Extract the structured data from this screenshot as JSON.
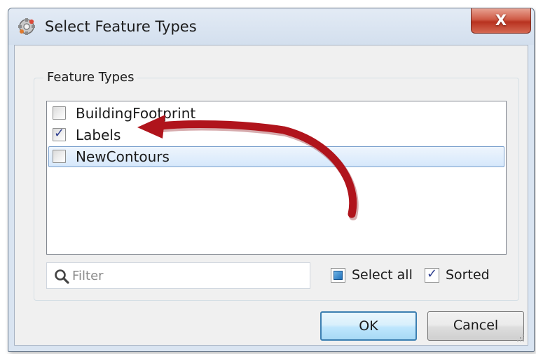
{
  "window": {
    "title": "Select Feature Types",
    "close_label": "X"
  },
  "feature_types": {
    "group_label": "Feature Types",
    "items": [
      {
        "label": "BuildingFootprint",
        "checked": false
      },
      {
        "label": "Labels",
        "checked": true
      },
      {
        "label": "NewContours",
        "checked": false,
        "selected": true
      }
    ]
  },
  "filter": {
    "placeholder": "Filter",
    "value": ""
  },
  "options": {
    "select_all_label": "Select all",
    "sorted_label": "Sorted",
    "sorted_checked": true
  },
  "buttons": {
    "ok": "OK",
    "cancel": "Cancel"
  },
  "colors": {
    "annotation_arrow": "#b0141c",
    "close_button": "#c7402c",
    "selection_border": "#7da2ce"
  }
}
